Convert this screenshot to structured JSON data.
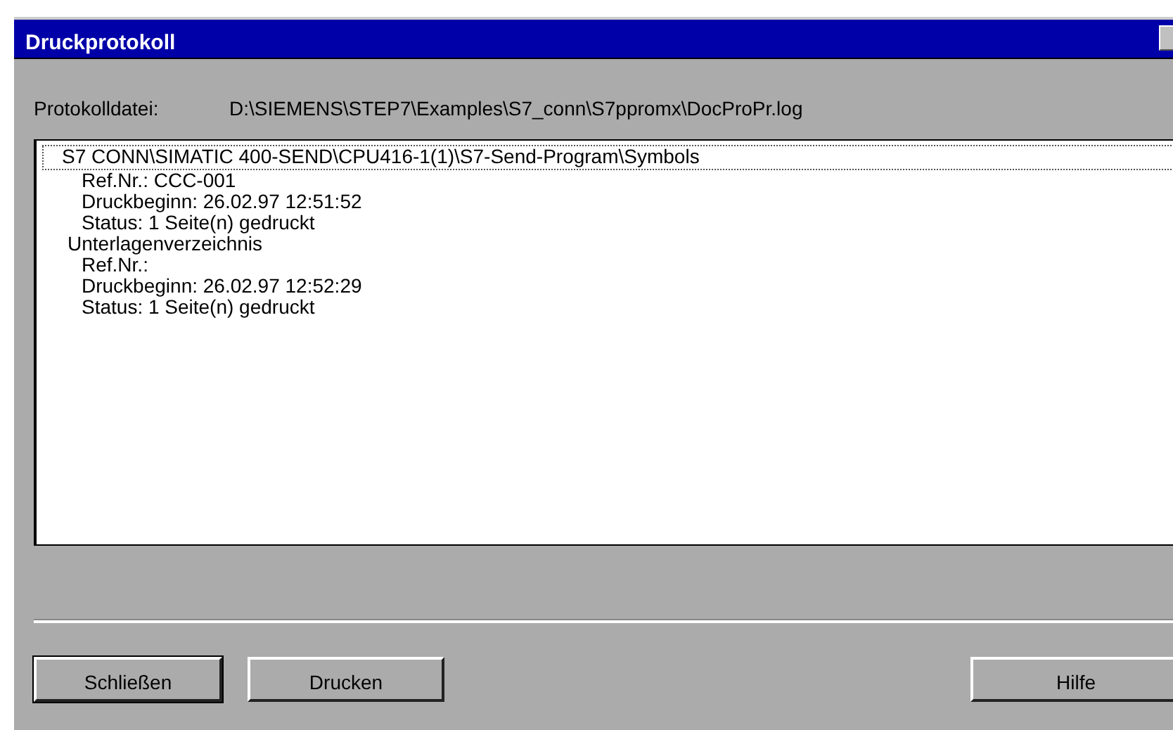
{
  "window": {
    "title": "Druckprotokoll"
  },
  "log_file": {
    "label": "Protokolldatei:",
    "value": "D:\\SIEMENS\\STEP7\\Examples\\S7_conn\\S7ppromx\\DocProPr.log"
  },
  "log_list": [
    {
      "text": "S7 CONN\\SIMATIC 400-SEND\\CPU416-1(1)\\S7-Send-Program\\Symbols",
      "selected": true,
      "children": [
        {
          "text": "Ref.Nr.: CCC-001"
        },
        {
          "text": "Druckbeginn: 26.02.97  12:51:52"
        },
        {
          "text": "Status: 1 Seite(n) gedruckt"
        }
      ]
    },
    {
      "text": "Unterlagenverzeichnis",
      "selected": false,
      "children": [
        {
          "text": "Ref.Nr.:"
        },
        {
          "text": "Druckbeginn: 26.02.97  12:52:29"
        },
        {
          "text": "Status: 1 Seite(n) gedruckt"
        }
      ]
    }
  ],
  "buttons": [
    {
      "label": "Schließen",
      "kind": "default"
    },
    {
      "label": "Drucken",
      "kind": "normal"
    },
    {
      "label": "Hilfe",
      "kind": "right"
    }
  ]
}
